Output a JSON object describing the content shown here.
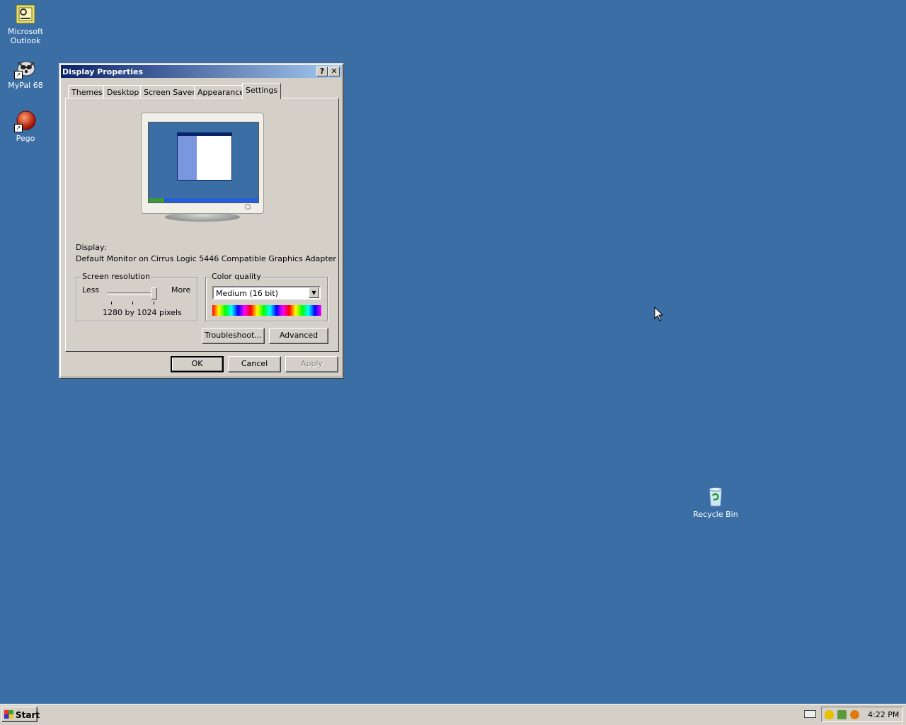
{
  "desktop": {
    "icons": [
      {
        "label_line1": "Microsoft",
        "label_line2": "Outlook",
        "icon": "outlook-icon"
      },
      {
        "label_line1": "MyPal 68",
        "label_line2": "",
        "icon": "mypal-icon"
      },
      {
        "label_line1": "Pego",
        "label_line2": "",
        "icon": "pego-icon"
      },
      {
        "label_line1": "Recycle Bin",
        "label_line2": "",
        "icon": "recycle-bin-icon"
      }
    ]
  },
  "dialog": {
    "title": "Display Properties",
    "help_glyph": "?",
    "close_glyph": "✕",
    "tabs": [
      {
        "label": "Themes"
      },
      {
        "label": "Desktop"
      },
      {
        "label": "Screen Saver"
      },
      {
        "label": "Appearance"
      },
      {
        "label": "Settings"
      }
    ],
    "active_tab": "Settings",
    "display_label": "Display:",
    "display_value": "Default Monitor on Cirrus Logic 5446 Compatible Graphics Adapter",
    "resolution": {
      "legend": "Screen resolution",
      "less": "Less",
      "more": "More",
      "value": "1280 by 1024 pixels"
    },
    "color_quality": {
      "legend": "Color quality",
      "selected": "Medium (16 bit)"
    },
    "buttons": {
      "troubleshoot": "Troubleshoot...",
      "advanced": "Advanced",
      "ok": "OK",
      "cancel": "Cancel",
      "apply": "Apply"
    }
  },
  "taskbar": {
    "start_label": "Start",
    "clock": "4:22 PM"
  },
  "colors": {
    "desktop": "#3a6ea5",
    "titlebar_start": "#0a246a",
    "titlebar_end": "#a6caf0",
    "face": "#d4d0c8"
  }
}
